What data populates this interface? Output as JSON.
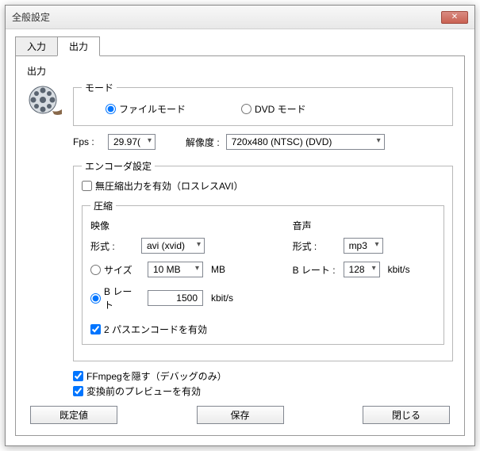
{
  "title": "全般設定",
  "tabs": {
    "input": "入力",
    "output": "出力"
  },
  "section_output": "出力",
  "mode": {
    "legend": "モード",
    "file": "ファイルモード",
    "dvd": "DVD モード"
  },
  "fps": {
    "label": "Fps :",
    "value": "29.97("
  },
  "resolution": {
    "label": "解像度 :",
    "value": "720x480 (NTSC) (DVD)"
  },
  "encoder": {
    "legend": "エンコーダ設定",
    "lossless": "無圧縮出力を有効（ロスレスAVI）",
    "compress_legend": "圧縮",
    "video_head": "映像",
    "audio_head": "音声",
    "format_label": "形式 :",
    "video_format": "avi (xvid)",
    "audio_format": "mp3",
    "size_label": "サイズ",
    "size_value": "10 MB",
    "size_unit": "MB",
    "bitrate_label": "B レート",
    "video_bitrate": "1500",
    "video_bitrate_unit": "kbit/s",
    "audio_bitrate_label": "B レート :",
    "audio_bitrate": "128",
    "audio_bitrate_unit": "kbit/s",
    "twopass": "2 パスエンコードを有効"
  },
  "hide_ffmpeg": "FFmpegを隠す（デバッグのみ）",
  "preview": "変換前のプレビューを有効",
  "buttons": {
    "defaults": "既定値",
    "save": "保存",
    "close": "閉じる"
  }
}
